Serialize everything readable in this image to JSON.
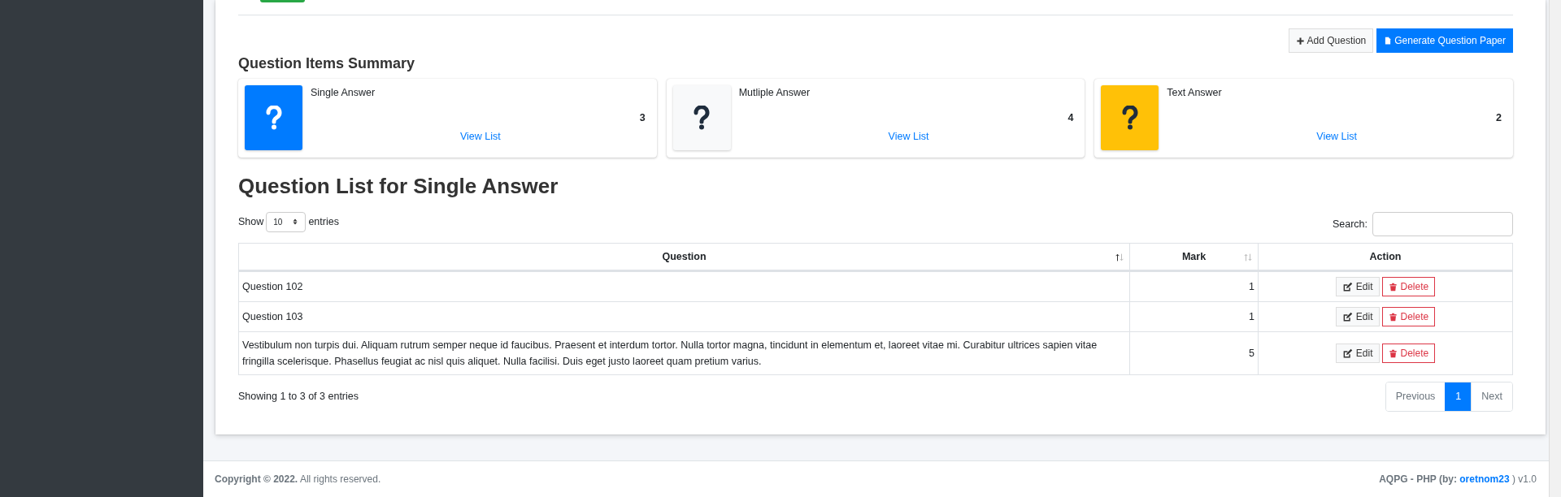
{
  "toolbar": [
    {
      "label": "Add Question",
      "kind": "default"
    },
    {
      "label": "Generate Question Paper",
      "kind": "primary"
    }
  ],
  "summary": {
    "title": "Question Items Summary",
    "cards": [
      {
        "label": "Single Answer",
        "count": "3",
        "link": "View List",
        "color": "#007bff"
      },
      {
        "label": "Mutliple Answer",
        "count": "4",
        "link": "View List",
        "color": "#f8f9fa"
      },
      {
        "label": "Text Answer",
        "count": "2",
        "link": "View List",
        "color": "#ffc107"
      }
    ]
  },
  "list": {
    "title": "Question List for Single Answer",
    "length_menu": {
      "before": "Show",
      "value": "10",
      "after": "entries"
    },
    "search": {
      "label": "Search:"
    },
    "table": {
      "columns": [
        {
          "label": "Question",
          "sortable": true,
          "sorted": true
        },
        {
          "label": "Mark",
          "sortable": true,
          "sorted": false
        },
        {
          "label": "Action",
          "sortable": false
        }
      ],
      "rows": [
        {
          "question": "Question 102",
          "mark": "1",
          "actions": [
            "Edit",
            "Delete"
          ]
        },
        {
          "question": "Question 103",
          "mark": "1",
          "actions": [
            "Edit",
            "Delete"
          ]
        },
        {
          "question": "Vestibulum non turpis dui. Aliquam rutrum semper neque id faucibus. Praesent et interdum tortor. Nulla tortor magna, tincidunt in elementum et, laoreet vitae mi. Curabitur ultrices sapien vitae fringilla scelerisque. Phasellus feugiat ac nisl quis aliquet. Nulla facilisi. Duis eget justo laoreet quam pretium varius.",
          "mark": "5",
          "actions": [
            "Edit",
            "Delete"
          ]
        }
      ]
    },
    "info": "Showing 1 to 3 of 3 entries",
    "pagination": [
      {
        "label": "Previous",
        "selected": false
      },
      {
        "label": "1",
        "selected": true
      },
      {
        "label": "Next",
        "selected": false
      }
    ]
  },
  "footer": {
    "copyright": "**Copyright © 2022.** All rights reserved.",
    "brand": "AQPG - PHP (by:",
    "author": "oretnom23",
    "version": ") v1.0"
  }
}
